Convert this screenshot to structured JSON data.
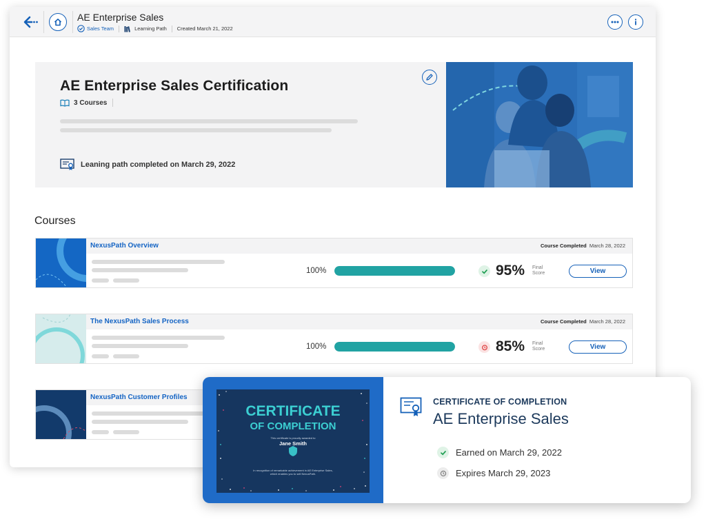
{
  "topbar": {
    "title": "AE Enterprise Sales",
    "team": "Sales Team",
    "type": "Learning Path",
    "created": "Created March 21, 2022"
  },
  "hero": {
    "title": "AE Enterprise Sales Certification",
    "course_count": "3 Courses",
    "completed_text": "Leaning path completed on March 29, 2022"
  },
  "courses": {
    "heading": "Courses",
    "items": [
      {
        "name": "NexusPath Overview",
        "status_label": "Course Completed",
        "status_date": "March 28, 2022",
        "progress_text": "100%",
        "progress": 1.0,
        "score": "95%",
        "score_label": "Final Score",
        "score_status": "passed",
        "view_label": "View"
      },
      {
        "name": "The NexusPath Sales Process",
        "status_label": "Course Completed",
        "status_date": "March 28, 2022",
        "progress_text": "100%",
        "progress": 1.0,
        "score": "85%",
        "score_label": "Final Score",
        "score_status": "warning",
        "view_label": "View"
      },
      {
        "name": "NexusPath Customer Profiles"
      }
    ]
  },
  "certificate": {
    "image": {
      "line1": "CERTIFICATE",
      "line2": "OF COMPLETION",
      "awarded": "This certificate is proudly awarded to",
      "recipient": "Jane Smith",
      "recognition": "In recognition of remarkable achievement in AE Enterprise Sales, which enables you to sell NexusPath."
    },
    "kicker": "CERTIFICATE OF COMPLETION",
    "title": "AE Enterprise Sales",
    "earned": "Earned on March 29, 2022",
    "expires": "Expires March 29, 2023"
  },
  "colors": {
    "accent": "#1460b8",
    "progress": "#21a3a3",
    "success": "#1e9e52",
    "warning": "#e04848"
  }
}
